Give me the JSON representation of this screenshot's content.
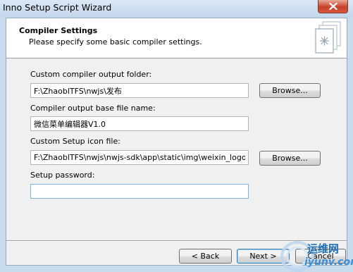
{
  "window": {
    "title": "Inno Setup Script Wizard"
  },
  "header": {
    "title": "Compiler Settings",
    "subtitle": "Please specify some basic compiler settings."
  },
  "form": {
    "output_folder": {
      "label": "Custom compiler output folder:",
      "value": "F:\\ZhaoblTFS\\nwjs\\发布"
    },
    "output_base_name": {
      "label": "Compiler output base file name:",
      "value": "微信菜单编辑器V1.0"
    },
    "icon_file": {
      "label": "Custom Setup icon file:",
      "value": "F:\\ZhaoblTFS\\nwjs\\nwjs-sdk\\app\\static\\img\\weixin_logo.ico"
    },
    "password": {
      "label": "Setup password:",
      "value": ""
    }
  },
  "buttons": {
    "browse_output": "Browse...",
    "browse_icon": "Browse...",
    "back": "< Back",
    "next": "Next >",
    "cancel": "Cancel"
  },
  "watermark": {
    "line1": "运维网",
    "line2": "iyunv.com"
  },
  "colors": {
    "titlebar": "#c4d7ec",
    "close_button": "#c7412a",
    "dialog_bg": "#f0f0f0",
    "header_bg": "#ffffff",
    "focus_border": "#7eb4ea"
  }
}
